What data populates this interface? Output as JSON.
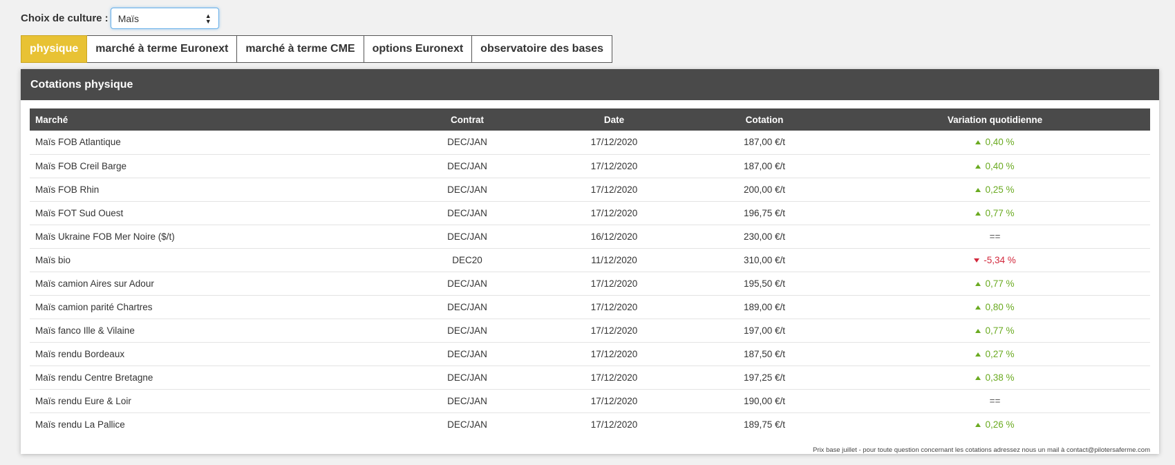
{
  "culture": {
    "label": "Choix de culture :",
    "selected": "Maïs"
  },
  "tabs": [
    {
      "label": "physique",
      "active": true
    },
    {
      "label": "marché à terme Euronext",
      "active": false
    },
    {
      "label": "marché à terme CME",
      "active": false
    },
    {
      "label": "options Euronext",
      "active": false
    },
    {
      "label": "observatoire des bases",
      "active": false
    }
  ],
  "panel": {
    "title": "Cotations physique"
  },
  "table": {
    "headers": {
      "marche": "Marché",
      "contrat": "Contrat",
      "date": "Date",
      "cotation": "Cotation",
      "variation": "Variation quotidienne"
    },
    "rows": [
      {
        "marche": "Maïs FOB Atlantique",
        "contrat": "DEC/JAN",
        "date": "17/12/2020",
        "cotation": "187,00 €/t",
        "variation": "0,40 %",
        "trend": "up"
      },
      {
        "marche": "Maïs FOB Creil Barge",
        "contrat": "DEC/JAN",
        "date": "17/12/2020",
        "cotation": "187,00 €/t",
        "variation": "0,40 %",
        "trend": "up"
      },
      {
        "marche": "Maïs FOB Rhin",
        "contrat": "DEC/JAN",
        "date": "17/12/2020",
        "cotation": "200,00 €/t",
        "variation": "0,25 %",
        "trend": "up"
      },
      {
        "marche": "Maïs FOT Sud Ouest",
        "contrat": "DEC/JAN",
        "date": "17/12/2020",
        "cotation": "196,75 €/t",
        "variation": "0,77 %",
        "trend": "up"
      },
      {
        "marche": "Maïs Ukraine FOB Mer Noire ($/t)",
        "contrat": "DEC/JAN",
        "date": "16/12/2020",
        "cotation": "230,00 €/t",
        "variation": "==",
        "trend": "flat"
      },
      {
        "marche": "Maïs bio",
        "contrat": "DEC20",
        "date": "11/12/2020",
        "cotation": "310,00 €/t",
        "variation": "-5,34 %",
        "trend": "down"
      },
      {
        "marche": "Maïs camion Aires sur Adour",
        "contrat": "DEC/JAN",
        "date": "17/12/2020",
        "cotation": "195,50 €/t",
        "variation": "0,77 %",
        "trend": "up"
      },
      {
        "marche": "Maïs camion parité Chartres",
        "contrat": "DEC/JAN",
        "date": "17/12/2020",
        "cotation": "189,00 €/t",
        "variation": "0,80 %",
        "trend": "up"
      },
      {
        "marche": "Maïs fanco Ille & Vilaine",
        "contrat": "DEC/JAN",
        "date": "17/12/2020",
        "cotation": "197,00 €/t",
        "variation": "0,77 %",
        "trend": "up"
      },
      {
        "marche": "Maïs rendu Bordeaux",
        "contrat": "DEC/JAN",
        "date": "17/12/2020",
        "cotation": "187,50 €/t",
        "variation": "0,27 %",
        "trend": "up"
      },
      {
        "marche": "Maïs rendu Centre Bretagne",
        "contrat": "DEC/JAN",
        "date": "17/12/2020",
        "cotation": "197,25 €/t",
        "variation": "0,38 %",
        "trend": "up"
      },
      {
        "marche": "Maïs rendu Eure & Loir",
        "contrat": "DEC/JAN",
        "date": "17/12/2020",
        "cotation": "190,00 €/t",
        "variation": "==",
        "trend": "flat"
      },
      {
        "marche": "Maïs rendu La Pallice",
        "contrat": "DEC/JAN",
        "date": "17/12/2020",
        "cotation": "189,75 €/t",
        "variation": "0,26 %",
        "trend": "up"
      }
    ]
  },
  "footnote": "Prix base juillet - pour toute question concernant les cotations adressez nous un mail à contact@pilotersaferme.com",
  "colors": {
    "active_tab": "#e8c234",
    "header_bg": "#4a4a4a",
    "up": "#6aaa20",
    "down": "#d2283c"
  }
}
